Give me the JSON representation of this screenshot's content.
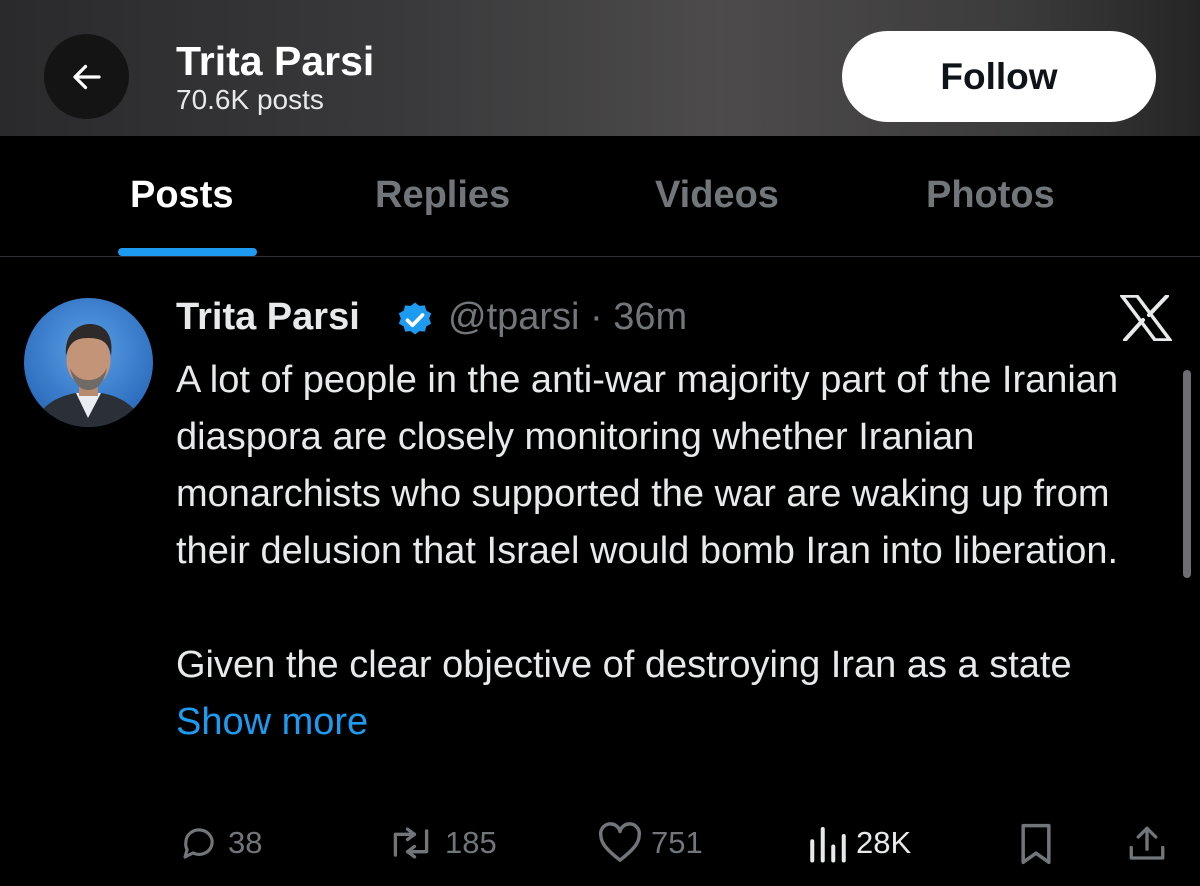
{
  "header": {
    "name": "Trita Parsi",
    "post_count": "70.6K posts",
    "follow_label": "Follow"
  },
  "tabs": [
    {
      "label": "Posts",
      "active": true
    },
    {
      "label": "Replies",
      "active": false
    },
    {
      "label": "Videos",
      "active": false
    },
    {
      "label": "Photos",
      "active": false
    }
  ],
  "post": {
    "author_name": "Trita Parsi",
    "handle_time": "@tparsi · 36m",
    "paragraph1": "A lot of people in the anti-war majority part of the Iranian diaspora are closely monitoring whether Iranian monarchists who supported the war are waking up from their delusion that Israel would bomb Iran into liberation.",
    "paragraph2": "Given the clear objective of destroying Iran as a state",
    "show_more": "Show more",
    "actions": {
      "replies": "38",
      "reposts": "185",
      "likes": "751",
      "views": "28K"
    }
  },
  "icons": {
    "back": "arrow-left-icon",
    "verified": "verified-badge-icon",
    "brand": "x-logo-icon",
    "reply": "reply-icon",
    "repost": "repost-icon",
    "like": "heart-icon",
    "views": "views-icon",
    "bookmark": "bookmark-icon",
    "share": "share-icon"
  },
  "colors": {
    "accent": "#1d9bf0",
    "background": "#000000",
    "muted": "#71767b",
    "text": "#e7e9ea"
  }
}
